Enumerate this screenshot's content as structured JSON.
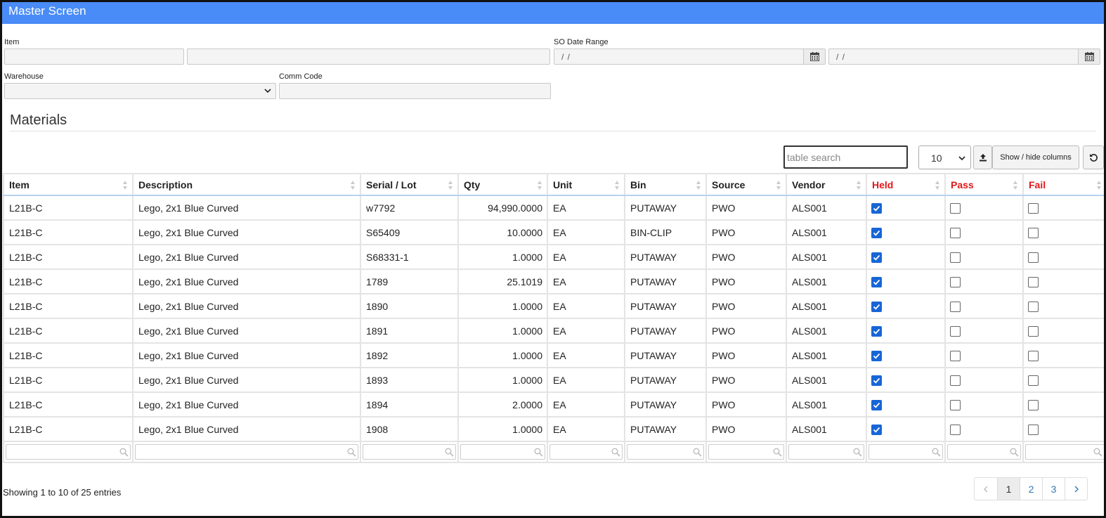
{
  "window": {
    "title": "Master Screen"
  },
  "filters": {
    "item_label": "Item",
    "item_code_value": "",
    "item_desc_value": "",
    "so_date_range_label": "SO Date Range",
    "date_from_value": "/ /",
    "date_to_value": "/ /",
    "warehouse_label": "Warehouse",
    "warehouse_value": "",
    "comm_code_label": "Comm Code",
    "comm_code_value": ""
  },
  "section": {
    "title": "Materials"
  },
  "toolbar": {
    "search_placeholder": "table search",
    "page_length": "10",
    "show_hide_label": "Show / hide columns",
    "export_icon": "upload-icon",
    "reset_icon": "refresh-icon"
  },
  "table": {
    "headers": [
      "Item",
      "Description",
      "Serial / Lot",
      "Qty",
      "Unit",
      "Bin",
      "Source",
      "Vendor",
      "Held",
      "Pass",
      "Fail"
    ],
    "rows": [
      {
        "item": "L21B-C",
        "description": "Lego, 2x1 Blue Curved",
        "serial": "w7792",
        "qty": "94,990.0000",
        "unit": "EA",
        "bin": "PUTAWAY",
        "source": "PWO",
        "vendor": "ALS001",
        "held": true,
        "pass": false,
        "fail": false
      },
      {
        "item": "L21B-C",
        "description": "Lego, 2x1 Blue Curved",
        "serial": "S65409",
        "qty": "10.0000",
        "unit": "EA",
        "bin": "BIN-CLIP",
        "source": "PWO",
        "vendor": "ALS001",
        "held": true,
        "pass": false,
        "fail": false
      },
      {
        "item": "L21B-C",
        "description": "Lego, 2x1 Blue Curved",
        "serial": "S68331-1",
        "qty": "1.0000",
        "unit": "EA",
        "bin": "PUTAWAY",
        "source": "PWO",
        "vendor": "ALS001",
        "held": true,
        "pass": false,
        "fail": false
      },
      {
        "item": "L21B-C",
        "description": "Lego, 2x1 Blue Curved",
        "serial": "1789",
        "qty": "25.1019",
        "unit": "EA",
        "bin": "PUTAWAY",
        "source": "PWO",
        "vendor": "ALS001",
        "held": true,
        "pass": false,
        "fail": false
      },
      {
        "item": "L21B-C",
        "description": "Lego, 2x1 Blue Curved",
        "serial": "1890",
        "qty": "1.0000",
        "unit": "EA",
        "bin": "PUTAWAY",
        "source": "PWO",
        "vendor": "ALS001",
        "held": true,
        "pass": false,
        "fail": false
      },
      {
        "item": "L21B-C",
        "description": "Lego, 2x1 Blue Curved",
        "serial": "1891",
        "qty": "1.0000",
        "unit": "EA",
        "bin": "PUTAWAY",
        "source": "PWO",
        "vendor": "ALS001",
        "held": true,
        "pass": false,
        "fail": false
      },
      {
        "item": "L21B-C",
        "description": "Lego, 2x1 Blue Curved",
        "serial": "1892",
        "qty": "1.0000",
        "unit": "EA",
        "bin": "PUTAWAY",
        "source": "PWO",
        "vendor": "ALS001",
        "held": true,
        "pass": false,
        "fail": false
      },
      {
        "item": "L21B-C",
        "description": "Lego, 2x1 Blue Curved",
        "serial": "1893",
        "qty": "1.0000",
        "unit": "EA",
        "bin": "PUTAWAY",
        "source": "PWO",
        "vendor": "ALS001",
        "held": true,
        "pass": false,
        "fail": false
      },
      {
        "item": "L21B-C",
        "description": "Lego, 2x1 Blue Curved",
        "serial": "1894",
        "qty": "2.0000",
        "unit": "EA",
        "bin": "PUTAWAY",
        "source": "PWO",
        "vendor": "ALS001",
        "held": true,
        "pass": false,
        "fail": false
      },
      {
        "item": "L21B-C",
        "description": "Lego, 2x1 Blue Curved",
        "serial": "1908",
        "qty": "1.0000",
        "unit": "EA",
        "bin": "PUTAWAY",
        "source": "PWO",
        "vendor": "ALS001",
        "held": true,
        "pass": false,
        "fail": false
      }
    ]
  },
  "footer": {
    "info": "Showing 1 to 10 of 25 entries",
    "pages": [
      "1",
      "2",
      "3"
    ],
    "active_page": "1",
    "prev_icon": "chevron-left-icon",
    "next_icon": "chevron-right-icon"
  },
  "colors": {
    "titlebar": "#4a8cf7",
    "status_header": "#e01818",
    "checkbox_checked": "#1766d6",
    "link": "#337ab7"
  }
}
